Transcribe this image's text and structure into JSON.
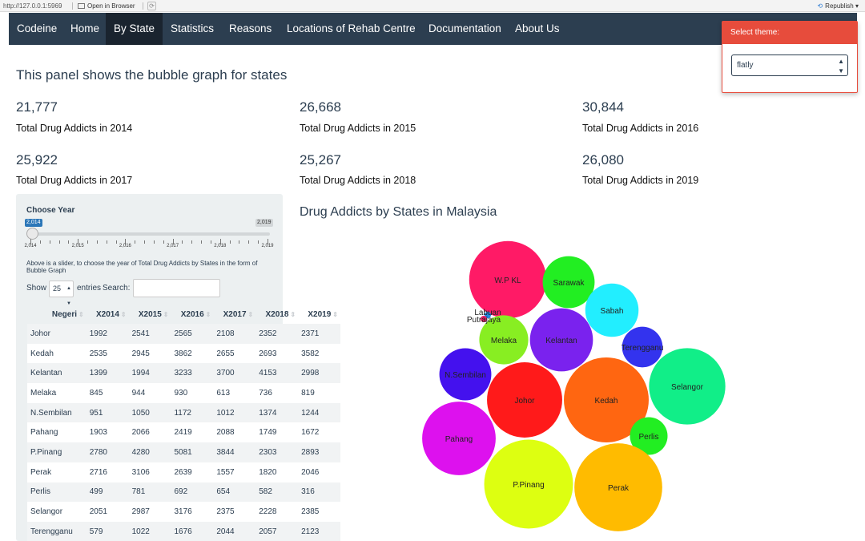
{
  "browser": {
    "url": "http://127.0.0.1:5969",
    "open_in_browser": "Open in Browser",
    "republish": "Republish"
  },
  "navbar": {
    "items": [
      "Codeine",
      "Home",
      "By State",
      "Statistics",
      "Reasons",
      "Locations of Rehab Centre",
      "Documentation",
      "About Us"
    ],
    "active": "By State"
  },
  "theme": {
    "header": "Select theme:",
    "selected": "flatly"
  },
  "panel_title": "This panel shows the bubble graph for states",
  "stats": [
    {
      "value": "21,777",
      "label": "Total Drug Addicts in 2014"
    },
    {
      "value": "26,668",
      "label": "Total Drug Addicts in 2015"
    },
    {
      "value": "30,844",
      "label": "Total Drug Addicts in 2016"
    },
    {
      "value": "25,922",
      "label": "Total Drug Addicts in 2017"
    },
    {
      "value": "25,267",
      "label": "Total Drug Addicts in 2018"
    },
    {
      "value": "26,080",
      "label": "Total Drug Addicts in 2019"
    }
  ],
  "slider": {
    "label": "Choose Year",
    "min": "2,014",
    "max": "2,019",
    "value": "2,014",
    "ticks": [
      "2,014",
      "2,015",
      "2,016",
      "2,017",
      "2,018",
      "2,019"
    ],
    "description": "Above is a slider, to choose the year of Total Drug Addicts by States in the form of Bubble Graph"
  },
  "table_controls": {
    "show": "Show",
    "entries_value": "25",
    "entries": "entries",
    "search": "Search:"
  },
  "table": {
    "headers": [
      "Negeri",
      "X2014",
      "X2015",
      "X2016",
      "X2017",
      "X2018",
      "X2019"
    ],
    "rows": [
      [
        "Johor",
        "1992",
        "2541",
        "2565",
        "2108",
        "2352",
        "2371"
      ],
      [
        "Kedah",
        "2535",
        "2945",
        "3862",
        "2655",
        "2693",
        "3582"
      ],
      [
        "Kelantan",
        "1399",
        "1994",
        "3233",
        "3700",
        "4153",
        "2998"
      ],
      [
        "Melaka",
        "845",
        "944",
        "930",
        "613",
        "736",
        "819"
      ],
      [
        "N.Sembilan",
        "951",
        "1050",
        "1172",
        "1012",
        "1374",
        "1244"
      ],
      [
        "Pahang",
        "1903",
        "2066",
        "2419",
        "2088",
        "1749",
        "1672"
      ],
      [
        "P.Pinang",
        "2780",
        "4280",
        "5081",
        "3844",
        "2303",
        "2893"
      ],
      [
        "Perak",
        "2716",
        "3106",
        "2639",
        "1557",
        "1820",
        "2046"
      ],
      [
        "Perlis",
        "499",
        "781",
        "692",
        "654",
        "582",
        "316"
      ],
      [
        "Selangor",
        "2051",
        "2987",
        "3176",
        "2375",
        "2228",
        "2385"
      ],
      [
        "Terengganu",
        "579",
        "1022",
        "1676",
        "2044",
        "2057",
        "2123"
      ]
    ]
  },
  "chart_title": "Drug Addicts by States in Malaysia",
  "chart_data": {
    "type": "bubble",
    "title": "Drug Addicts by States in Malaysia",
    "year": "2014",
    "bubbles": [
      {
        "label": "W.P KL",
        "value": 2100,
        "color": "#ff1a66"
      },
      {
        "label": "Sarawak",
        "value": 950,
        "color": "#22ee22"
      },
      {
        "label": "Sabah",
        "value": 1000,
        "color": "#22eeff"
      },
      {
        "label": "Labuan",
        "value": 15,
        "color": "#1e88e5"
      },
      {
        "label": "Putrajaya",
        "value": 12,
        "color": "#e91e63"
      },
      {
        "label": "Melaka",
        "value": 845,
        "color": "#88ee22"
      },
      {
        "label": "Kelantan",
        "value": 1399,
        "color": "#7a22ee"
      },
      {
        "label": "Terengganu",
        "value": 579,
        "color": "#3333ee"
      },
      {
        "label": "N.Sembilan",
        "value": 951,
        "color": "#4411ee"
      },
      {
        "label": "Johor",
        "value": 1992,
        "color": "#ff1a1a"
      },
      {
        "label": "Kedah",
        "value": 2535,
        "color": "#ff6611"
      },
      {
        "label": "Selangor",
        "value": 2051,
        "color": "#11ee88"
      },
      {
        "label": "Pahang",
        "value": 1903,
        "color": "#dd11ee"
      },
      {
        "label": "Perlis",
        "value": 499,
        "color": "#22ee22"
      },
      {
        "label": "P.Pinang",
        "value": 2780,
        "color": "#ddff11"
      },
      {
        "label": "Perak",
        "value": 2716,
        "color": "#ffbb00"
      }
    ]
  }
}
